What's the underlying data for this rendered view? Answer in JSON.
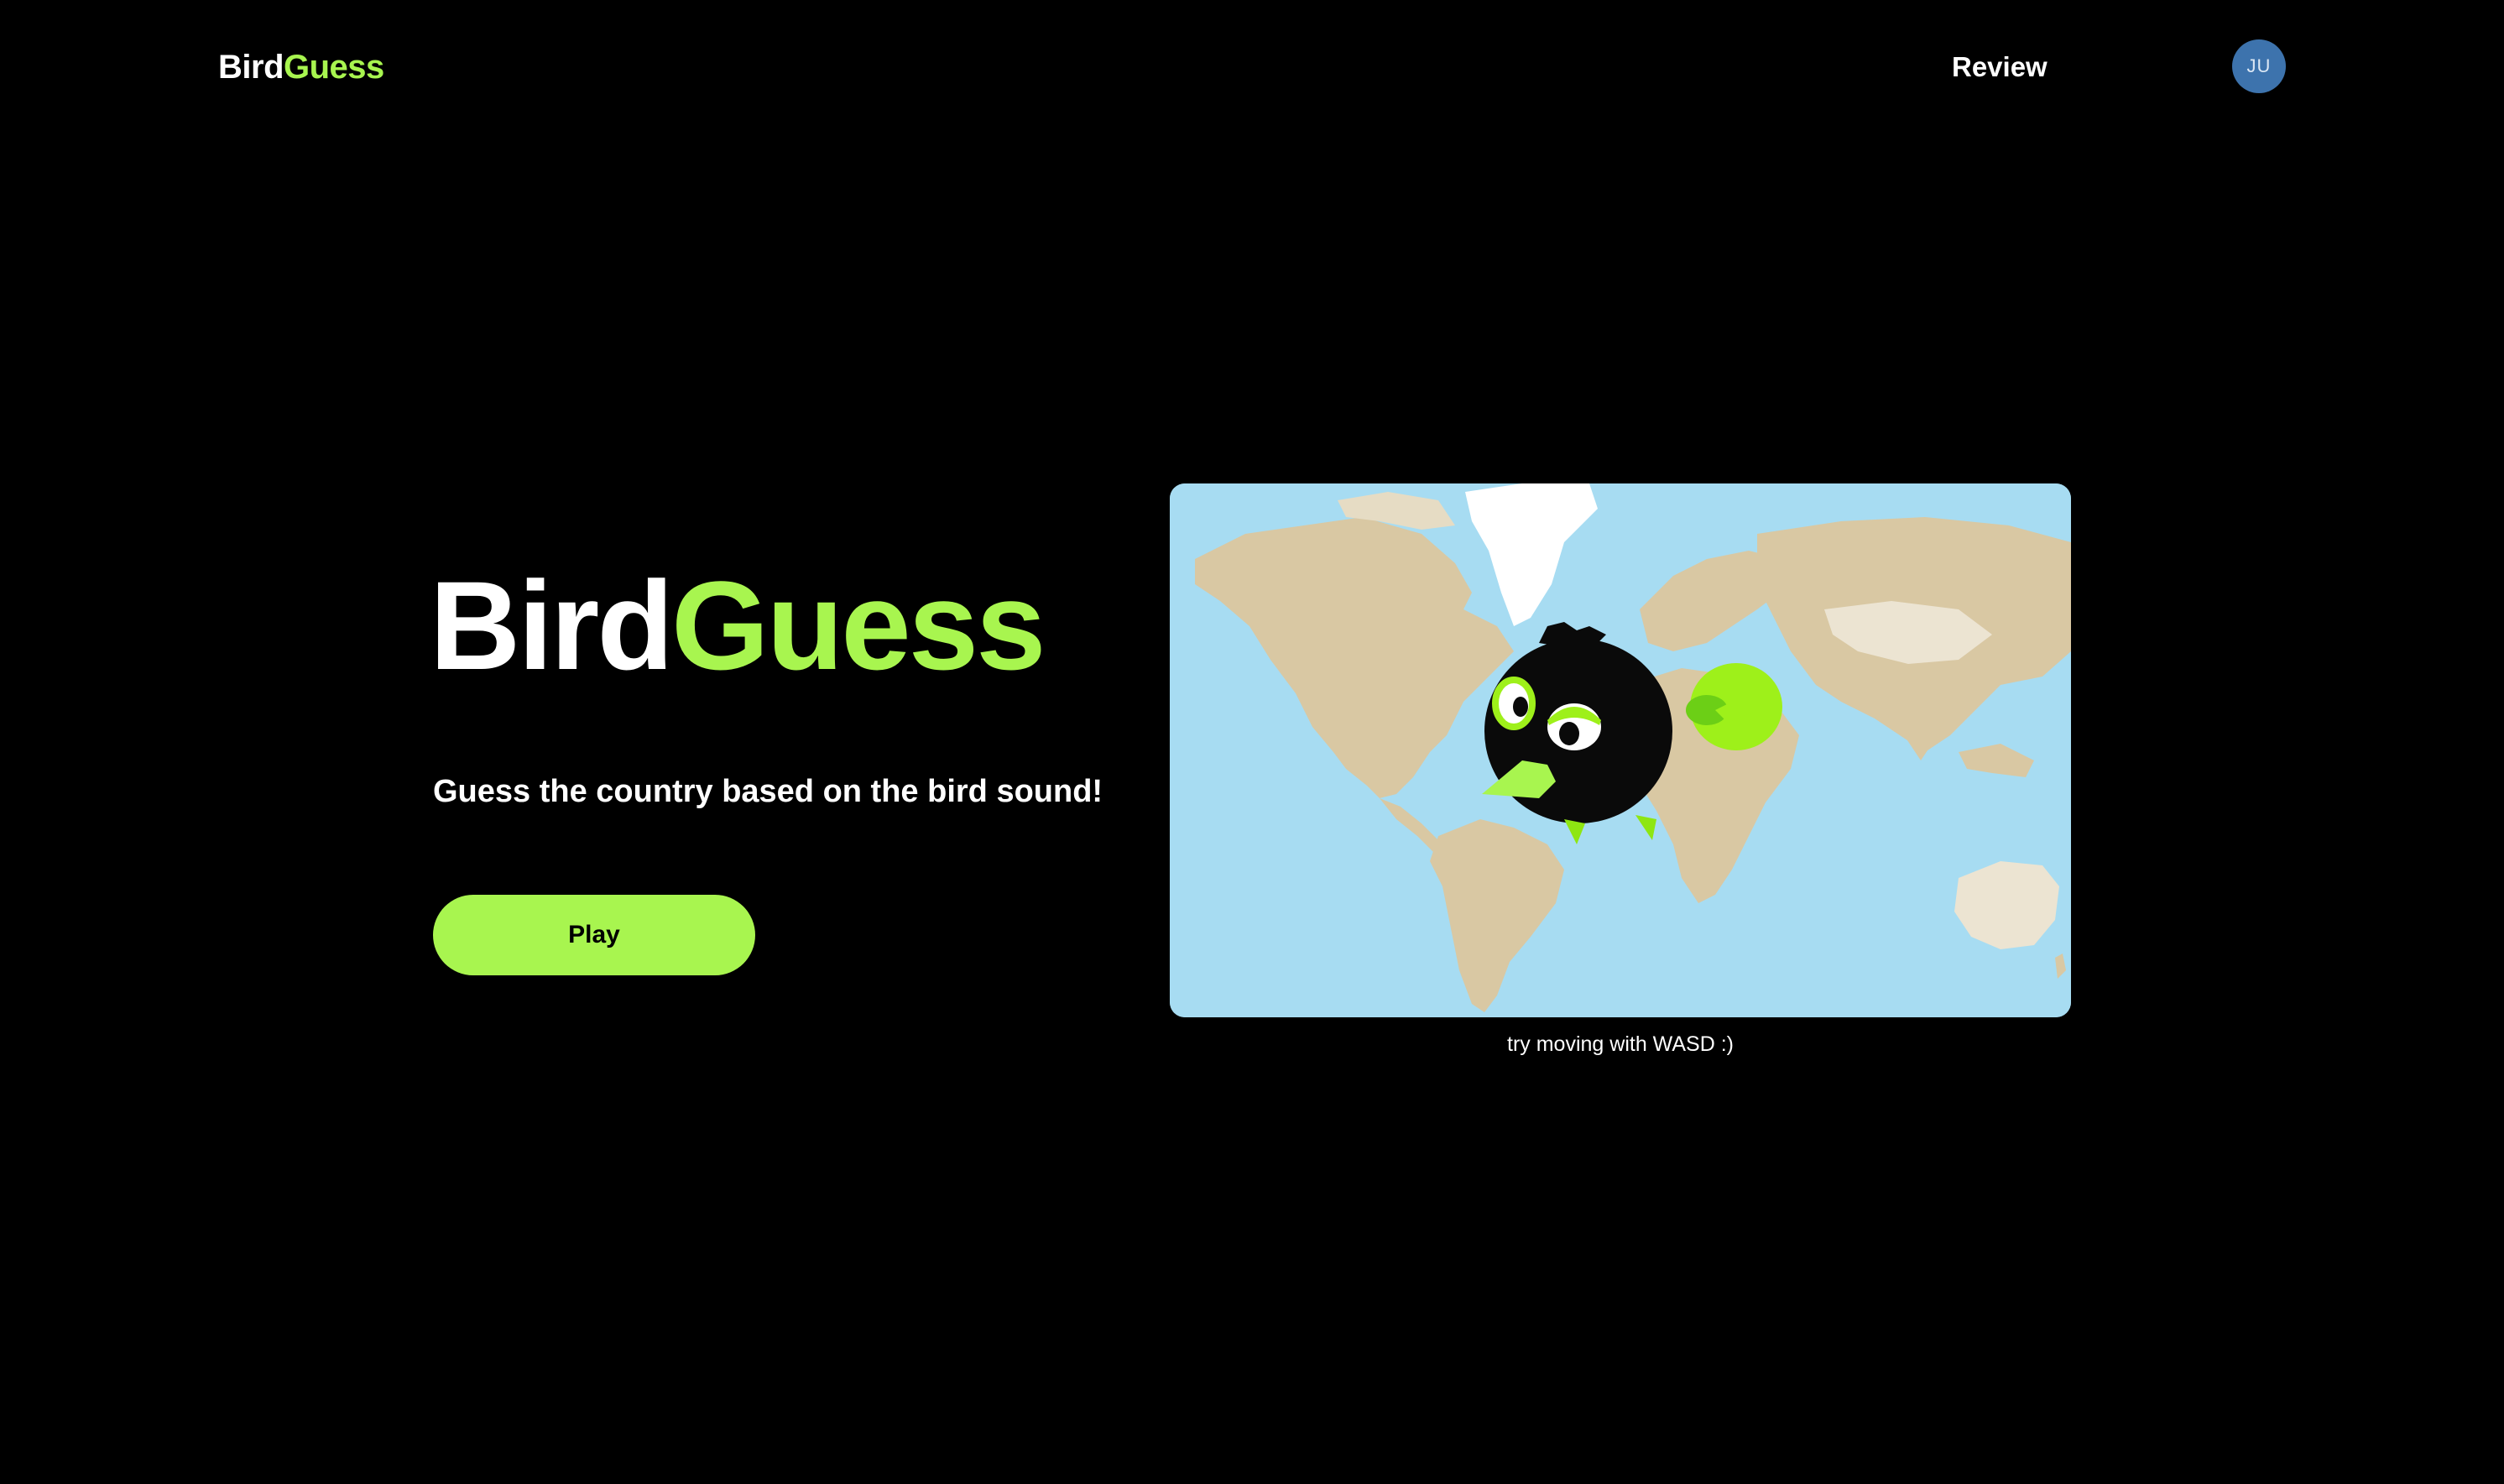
{
  "header": {
    "logo_part1": "Bird",
    "logo_part2": "Guess",
    "nav_review": "Review",
    "avatar_initials": "JU"
  },
  "hero": {
    "title_part1": "Bird",
    "title_part2": "Guess",
    "subtitle": "Guess the country based on the bird sound!",
    "play_label": "Play"
  },
  "map": {
    "caption": "try moving with WASD :)",
    "ocean_color": "#a7dcf2",
    "land_color": "#d9c8a3",
    "ice_color": "#ffffff"
  },
  "colors": {
    "accent": "#a8f54f",
    "background": "#000000",
    "avatar": "#3d73ad"
  },
  "icons": {
    "character": "bird-character-icon"
  }
}
